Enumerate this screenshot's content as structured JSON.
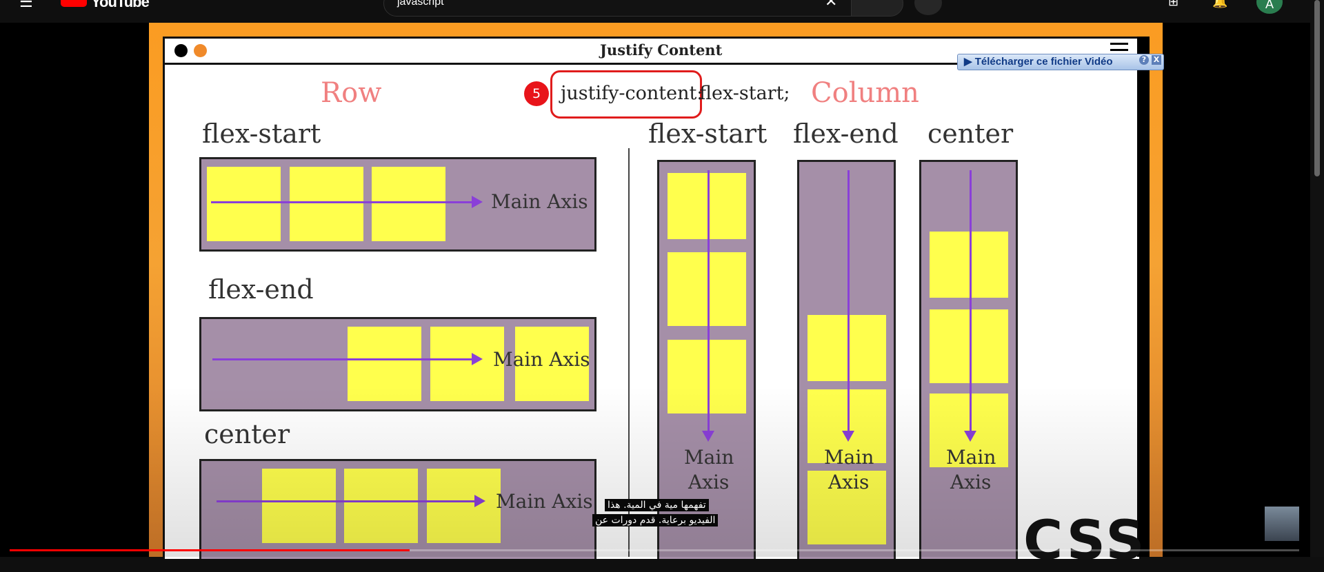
{
  "topbar": {
    "logo_text": "YouTube",
    "search_query": "javascript",
    "avatar_letter": "A",
    "icons": [
      "menu-icon",
      "youtube-logo-icon",
      "clear-icon",
      "search-icon",
      "mic-icon",
      "create-icon",
      "bell-icon"
    ]
  },
  "slide": {
    "title": "Justify Content",
    "row_heading": "Row",
    "column_heading": "Column",
    "step_number": "5",
    "code_property": "justify-content:",
    "code_value": "flex-start;",
    "row_examples": [
      {
        "label": "flex-start",
        "axis_label": "Main Axis"
      },
      {
        "label": "flex-end",
        "axis_label": "Main Axis"
      },
      {
        "label": "center",
        "axis_label": "Main Axis"
      }
    ],
    "column_examples": [
      {
        "label": "flex-start",
        "axis_line1": "Main",
        "axis_line2": "Axis"
      },
      {
        "label": "flex-end",
        "axis_line1": "Main",
        "axis_line2": "Axis"
      },
      {
        "label": "center",
        "axis_line1": "Main",
        "axis_line2": "Axis"
      }
    ],
    "logo_text": "CSS"
  },
  "download_overlay": {
    "label": "▶ Télécharger ce fichier Vidéo",
    "help": "?",
    "close": "X"
  },
  "captions": {
    "line1": "تفهمها مية في المية. هذا",
    "line2": "الفيديو برعاية. قدم دورات عن"
  },
  "player": {
    "progress_fraction": 0.31
  },
  "colors": {
    "row_col_heading": "#f08080",
    "box_fill": "#a58fa8",
    "item_fill": "#ffff4d",
    "arrow": "#8a3fd8",
    "frame_orange": "#fb9c22",
    "progress": "#ff0000"
  }
}
